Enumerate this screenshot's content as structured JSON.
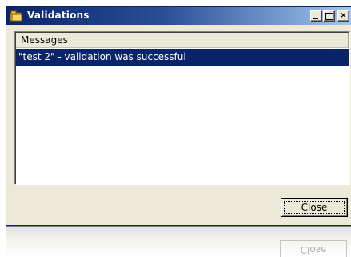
{
  "window": {
    "title": "Validations",
    "icon": "folder-icon",
    "controls": {
      "minimize": "minimize-icon",
      "maximize": "maximize-icon",
      "close": "close-icon",
      "close_glyph": "×"
    }
  },
  "list": {
    "column_header": "Messages",
    "rows": [
      {
        "message": "\"test 2\" - validation was successful",
        "selected": true
      }
    ]
  },
  "buttons": {
    "close_label": "Close"
  },
  "colors": {
    "titlebar_start": "#0a246a",
    "titlebar_end": "#a6caf0",
    "selection": "#0a246a",
    "window_bg": "#ece9d8"
  }
}
